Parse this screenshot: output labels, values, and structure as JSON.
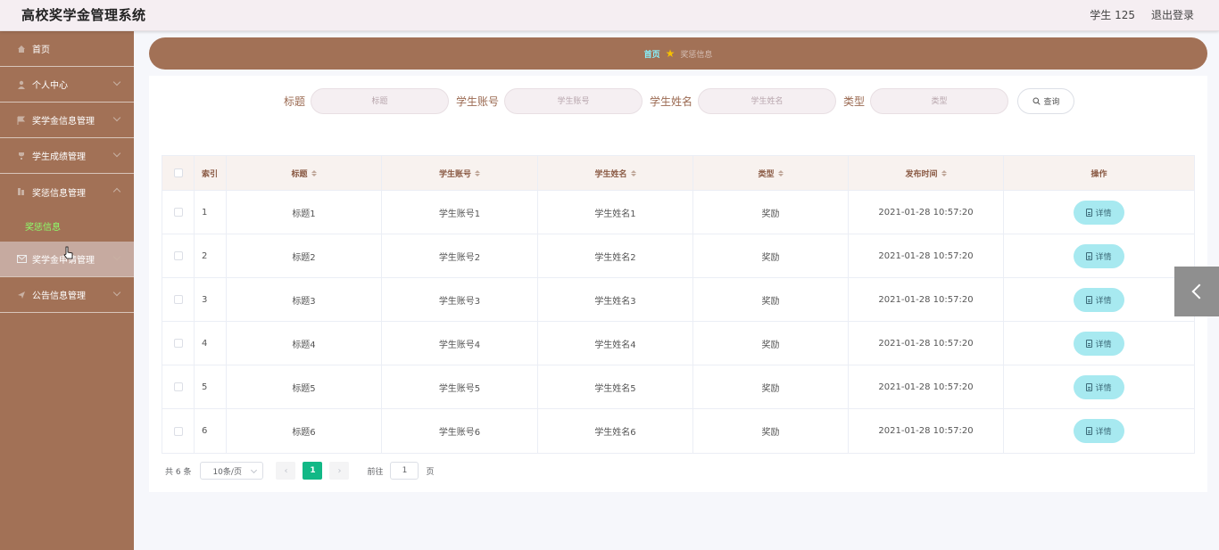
{
  "header": {
    "title": "高校奖学金管理系统",
    "user": "学生 125",
    "logout": "退出登录"
  },
  "sidebar": {
    "items": [
      {
        "label": "首页",
        "icon": "home-icon"
      },
      {
        "label": "个人中心",
        "icon": "user-icon"
      },
      {
        "label": "奖学金信息管理",
        "icon": "flag-icon"
      },
      {
        "label": "学生成绩管理",
        "icon": "trophy-icon"
      },
      {
        "label": "奖惩信息管理",
        "icon": "grid-icon"
      },
      {
        "label": "奖学金申请管理",
        "icon": "mail-icon"
      },
      {
        "label": "公告信息管理",
        "icon": "send-icon"
      }
    ],
    "submenu_active": "奖惩信息"
  },
  "breadcrumb": {
    "home": "首页",
    "current": "奖惩信息"
  },
  "search": {
    "title_label": "标题",
    "title_placeholder": "标题",
    "account_label": "学生账号",
    "account_placeholder": "学生账号",
    "name_label": "学生姓名",
    "name_placeholder": "学生姓名",
    "type_label": "类型",
    "type_placeholder": "类型",
    "query_button": "查询"
  },
  "table": {
    "headers": {
      "index": "索引",
      "title": "标题",
      "account": "学生账号",
      "name": "学生姓名",
      "type": "类型",
      "time": "发布时间",
      "op": "操作"
    },
    "detail_label": "详情",
    "rows": [
      {
        "index": "1",
        "title": "标题1",
        "account": "学生账号1",
        "name": "学生姓名1",
        "type": "奖励",
        "time": "2021-01-28 10:57:20"
      },
      {
        "index": "2",
        "title": "标题2",
        "account": "学生账号2",
        "name": "学生姓名2",
        "type": "奖励",
        "time": "2021-01-28 10:57:20"
      },
      {
        "index": "3",
        "title": "标题3",
        "account": "学生账号3",
        "name": "学生姓名3",
        "type": "奖励",
        "time": "2021-01-28 10:57:20"
      },
      {
        "index": "4",
        "title": "标题4",
        "account": "学生账号4",
        "name": "学生姓名4",
        "type": "奖励",
        "time": "2021-01-28 10:57:20"
      },
      {
        "index": "5",
        "title": "标题5",
        "account": "学生账号5",
        "name": "学生姓名5",
        "type": "奖励",
        "time": "2021-01-28 10:57:20"
      },
      {
        "index": "6",
        "title": "标题6",
        "account": "学生账号6",
        "name": "学生姓名6",
        "type": "奖励",
        "time": "2021-01-28 10:57:20"
      }
    ]
  },
  "pagination": {
    "total": "共 6 条",
    "page_size": "10条/页",
    "prev": "‹",
    "current_page": "1",
    "next": "›",
    "goto_label": "前往",
    "goto_value": "1",
    "page_suffix": "页"
  },
  "colors": {
    "sidebar": "#a27156",
    "accent_active": "#8dff6a",
    "pager_active": "#12b886",
    "detail_button": "#a7e9f0"
  }
}
